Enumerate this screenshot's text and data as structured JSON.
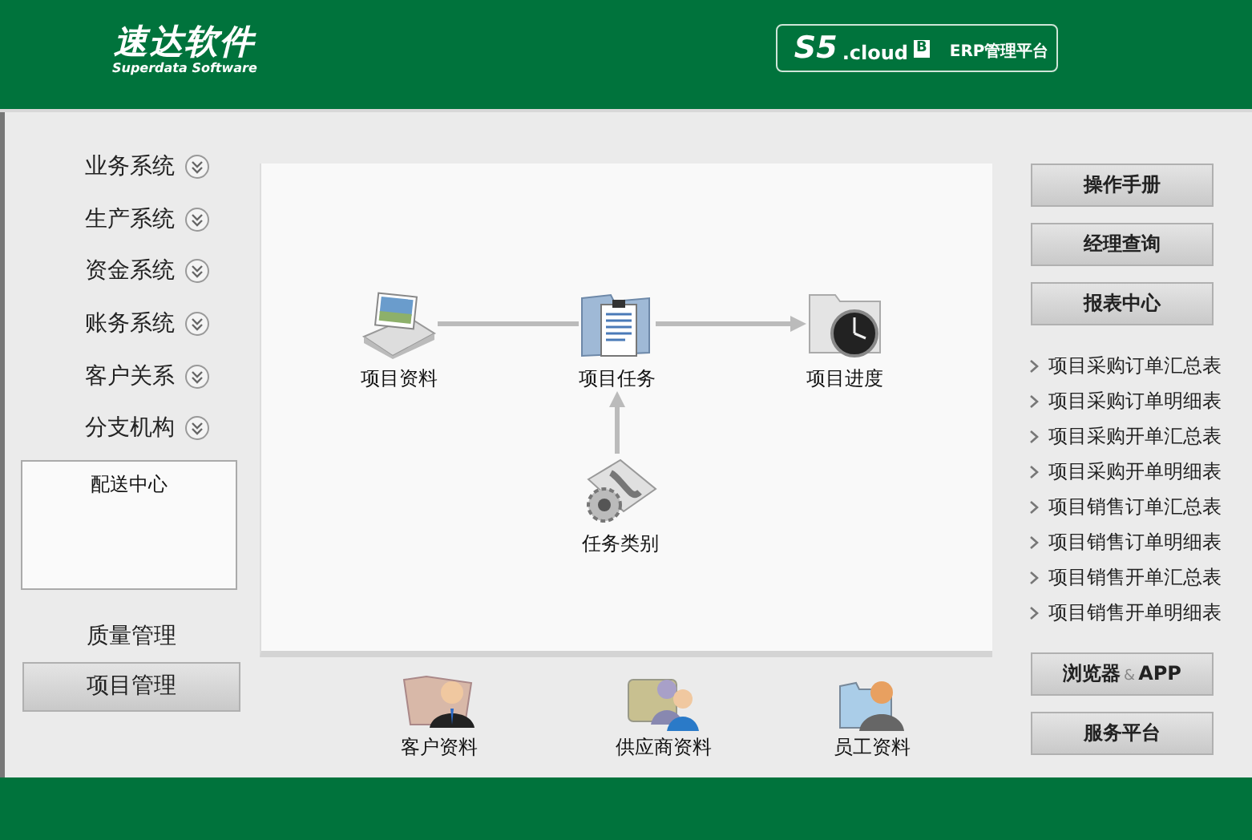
{
  "header": {
    "logo": "速达软件",
    "logo_subtitle": "Superdata Software",
    "product": {
      "name": "S5",
      "suffix": ".cloud",
      "edition": "B",
      "title": "ERP管理平台"
    }
  },
  "left_nav": {
    "groups": [
      {
        "label": "业务系统"
      },
      {
        "label": "生产系统"
      },
      {
        "label": "资金系统"
      },
      {
        "label": "账务系统"
      },
      {
        "label": "客户关系"
      },
      {
        "label": "分支机构"
      }
    ],
    "sub_items": [
      "配送中心"
    ],
    "modules": [
      {
        "label": "质量管理",
        "selected": false
      },
      {
        "label": "项目管理",
        "selected": true
      }
    ]
  },
  "flow": {
    "nodes": [
      {
        "label": "项目资料",
        "kind": "photo"
      },
      {
        "label": "项目任务",
        "kind": "clipboard"
      },
      {
        "label": "项目进度",
        "kind": "clock"
      },
      {
        "label": "任务类别",
        "kind": "tools"
      }
    ]
  },
  "shortcuts": [
    {
      "label": "客户资料",
      "kind": "customer"
    },
    {
      "label": "供应商资料",
      "kind": "supplier"
    },
    {
      "label": "员工资料",
      "kind": "employee"
    }
  ],
  "right_panel": {
    "top_buttons": [
      "操作手册",
      "经理查询",
      "报表中心"
    ],
    "report_links": [
      "项目采购订单汇总表",
      "项目采购订单明细表",
      "项目采购开单汇总表",
      "项目采购开单明细表",
      "项目销售订单汇总表",
      "项目销售订单明细表",
      "项目销售开单汇总表",
      "项目销售开单明细表"
    ],
    "bottom_buttons": [
      {
        "label": "浏览器",
        "connector": "&",
        "suffix": "APP"
      },
      {
        "label": "服务平台"
      }
    ]
  }
}
